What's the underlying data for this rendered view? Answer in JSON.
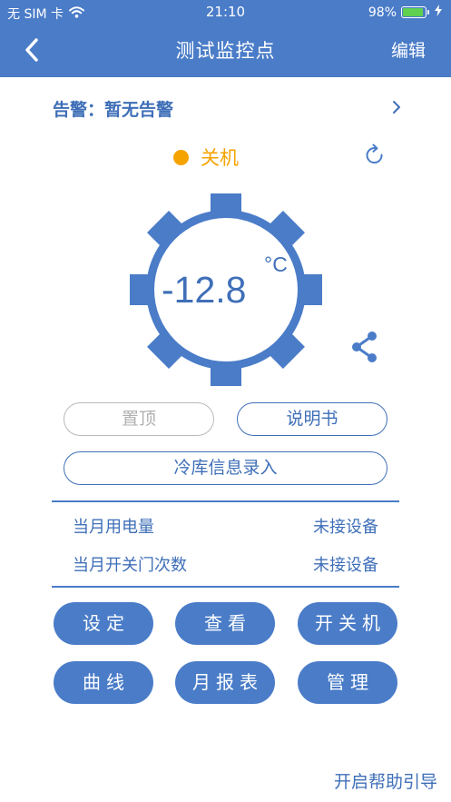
{
  "status_bar": {
    "carrier": "无 SIM 卡",
    "time": "21:10",
    "battery": "98%"
  },
  "nav": {
    "title": "测试监控点",
    "edit_label": "编辑"
  },
  "alarm": {
    "text": "告警：暂无告警"
  },
  "device_state": {
    "label": "关机",
    "color": "#f5a300"
  },
  "gauge": {
    "temperature": "-12.8",
    "unit": "°C"
  },
  "buttons": {
    "pin_top": "置顶",
    "manual": "说明书",
    "cold_storage_entry": "冷库信息录入"
  },
  "info": [
    {
      "label": "当月用电量",
      "value": "未接设备"
    },
    {
      "label": "当月开关门次数",
      "value": "未接设备"
    }
  ],
  "actions": [
    "设定",
    "查看",
    "开关机",
    "曲线",
    "月报表",
    "管理"
  ],
  "help_link": "开启帮助引导",
  "colors": {
    "primary": "#4a7cc8",
    "text_primary": "#3f6fb8",
    "status_off": "#f5a300",
    "disabled": "#b0b0b0"
  },
  "icons": {
    "back": "chevron-left-icon",
    "refresh": "refresh-icon",
    "share": "share-icon",
    "alarm_arrow": "chevron-right-icon",
    "wifi": "wifi-icon",
    "battery": "battery-icon",
    "charging": "bolt-icon"
  }
}
